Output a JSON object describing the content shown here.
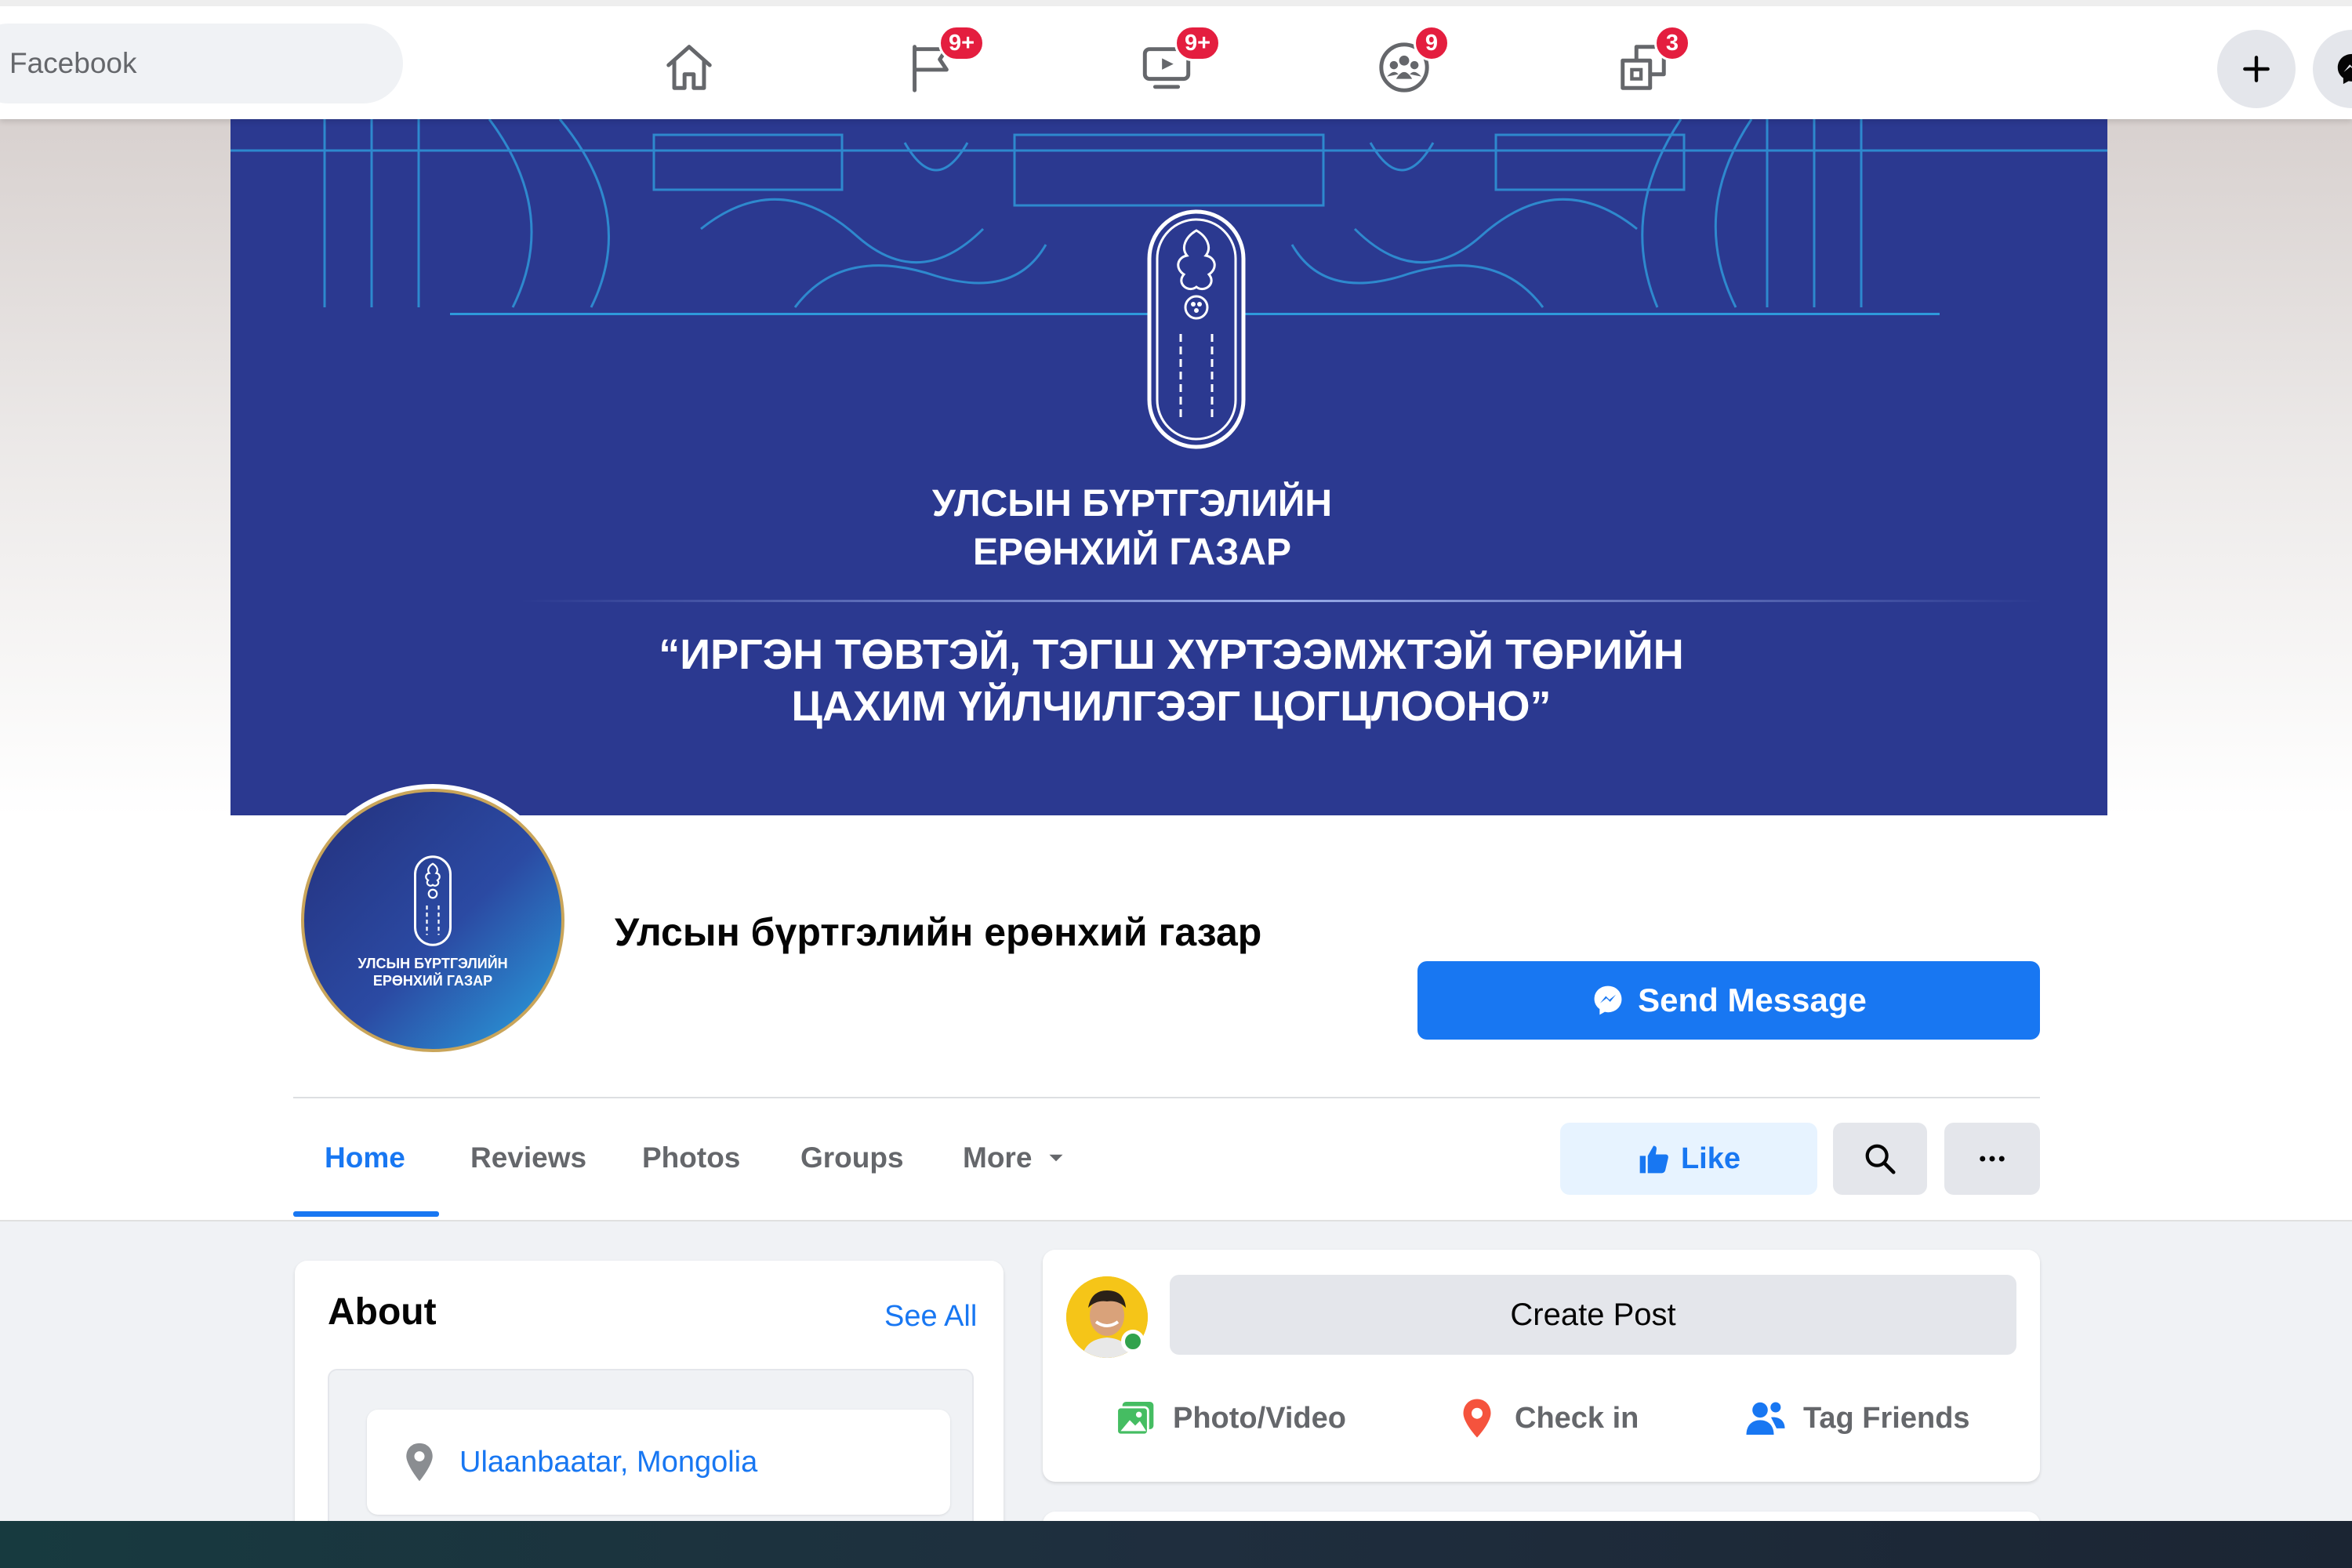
{
  "search": {
    "placeholder": "Facebook"
  },
  "nav": {
    "tabs": [
      {
        "name": "home",
        "badge": ""
      },
      {
        "name": "pages",
        "badge": "9+"
      },
      {
        "name": "watch",
        "badge": "9+"
      },
      {
        "name": "groups",
        "badge": "9"
      },
      {
        "name": "gaming",
        "badge": "3"
      }
    ],
    "create_icon": "plus-icon",
    "messenger_icon": "messenger-icon"
  },
  "cover": {
    "org_line1": "УЛСЫН БҮРТГЭЛИЙН",
    "org_line2": "ЕРӨНХИЙ ГАЗАР",
    "slogan_line1": "“ИРГЭН ТӨВТЭЙ, ТЭГШ ХҮРТЭЭМЖТЭЙ ТӨРИЙН",
    "slogan_line2": "ЦАХИМ ҮЙЛЧИЛГЭЭГ ЦОГЦЛООНО”",
    "color": "#2b3990"
  },
  "profile": {
    "avatar_line1": "УЛСЫН БҮРТГЭЛИЙН",
    "avatar_line2": "ЕРӨНХИЙ ГАЗАР",
    "page_name": "Улсын бүртгэлийн ерөнхий газар",
    "send_message": "Send Message"
  },
  "tabs": {
    "items": [
      "Home",
      "Reviews",
      "Photos",
      "Groups",
      "More"
    ],
    "active": "Home"
  },
  "actions": {
    "like": "Like"
  },
  "about": {
    "title": "About",
    "see_all": "See All",
    "location": "Ulaanbaatar, Mongolia"
  },
  "composer": {
    "create_post": "Create Post",
    "photo_video": "Photo/Video",
    "check_in": "Check in",
    "tag_friends": "Tag Friends"
  },
  "colors": {
    "accent": "#1877f2",
    "badge": "#e41e3f",
    "online": "#31a24c"
  }
}
